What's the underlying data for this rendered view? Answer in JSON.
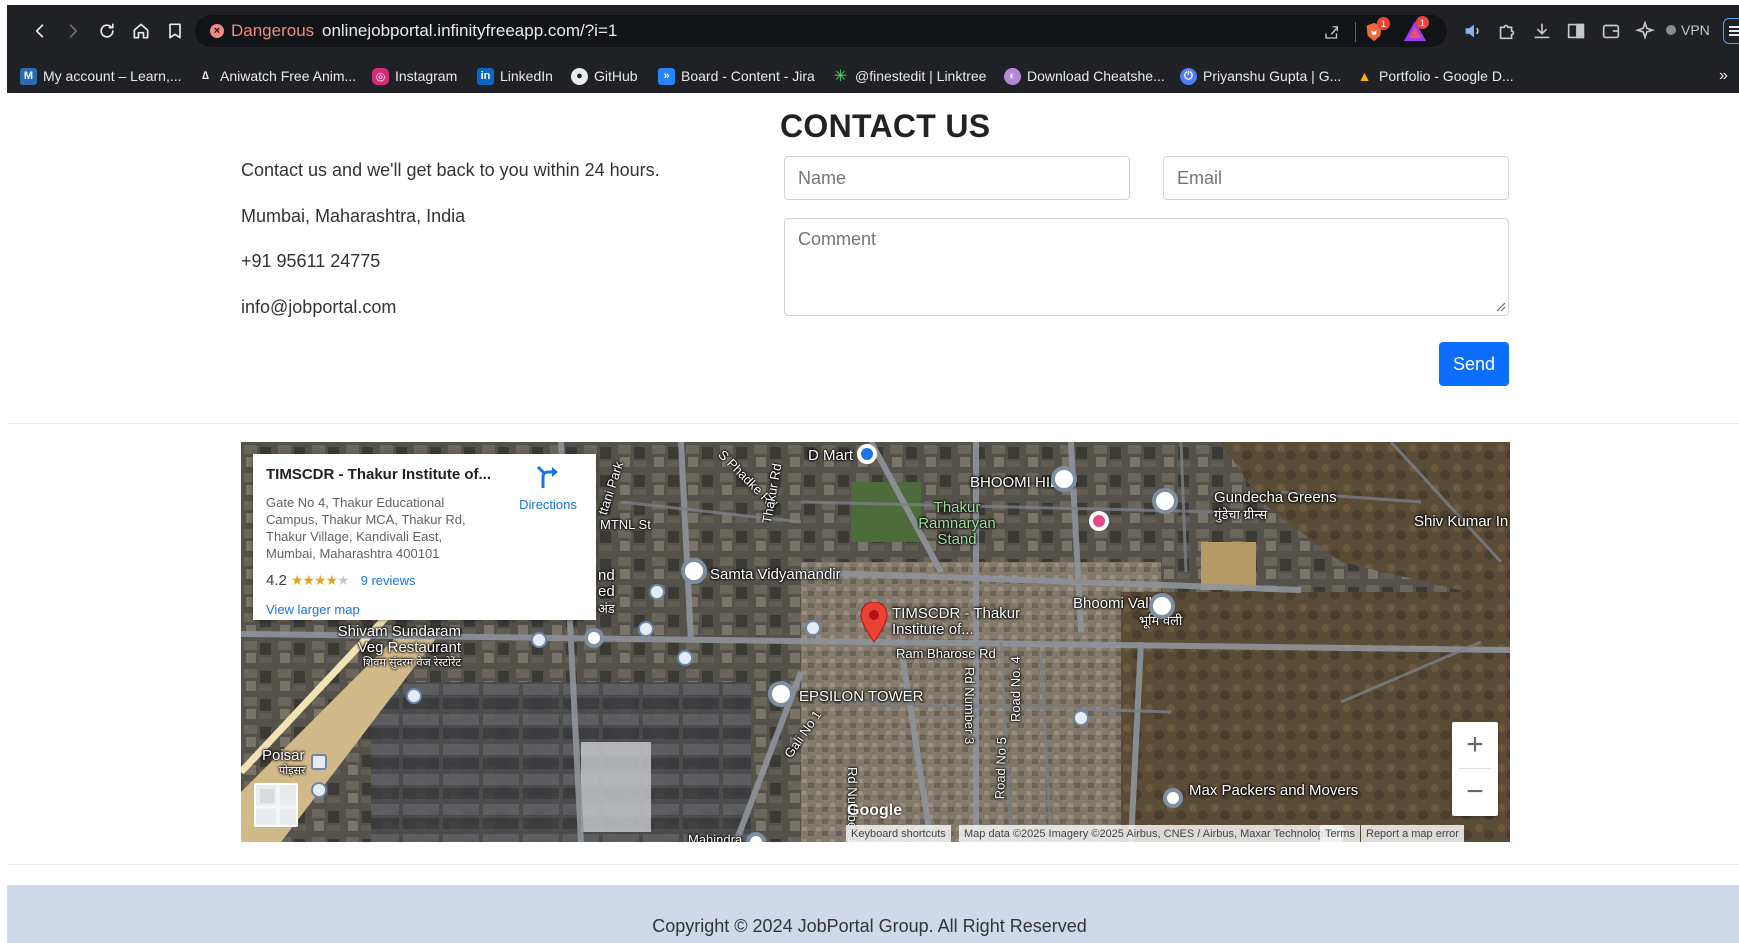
{
  "browser": {
    "security_label": "Dangerous",
    "url": "onlinejobportal.infinityfreeapp.com/?i=1",
    "shield_badge": "1",
    "alert_badge": "1",
    "vpn_label": "VPN",
    "bookmarks": [
      {
        "label": "My account – Learn,...",
        "icon": "account-icon",
        "color": "#2b6cb0"
      },
      {
        "label": "Aniwatch Free Anim...",
        "icon": "aniwatch-icon",
        "color": "#6b6b6b"
      },
      {
        "label": "Instagram",
        "icon": "instagram-icon",
        "color": "#d62976"
      },
      {
        "label": "LinkedIn",
        "icon": "linkedin-icon",
        "color": "#0a66c2"
      },
      {
        "label": "GitHub",
        "icon": "github-icon",
        "color": "#e8eaed"
      },
      {
        "label": "Board - Content - Jira",
        "icon": "jira-icon",
        "color": "#2684ff"
      },
      {
        "label": "@finestedit | Linktree",
        "icon": "linktree-icon",
        "color": "#43e55e"
      },
      {
        "label": "Download Cheatshe...",
        "icon": "cheatsheet-icon",
        "color": "#b48ad8"
      },
      {
        "label": "Priyanshu Gupta | G...",
        "icon": "power-icon",
        "color": "#4f7ff5"
      },
      {
        "label": "Portfolio - Google D...",
        "icon": "drive-icon",
        "color": "#f4b400"
      }
    ]
  },
  "contact": {
    "title": "CONTACT US",
    "intro": "Contact us and we'll get back to you within 24 hours.",
    "address": "Mumbai, Maharashtra, India",
    "phone": "+91 95611 24775",
    "email": "info@jobportal.com",
    "form": {
      "name_placeholder": "Name",
      "email_placeholder": "Email",
      "comment_placeholder": "Comment",
      "send_label": "Send"
    }
  },
  "map": {
    "place_name": "TIMSCDR - Thakur Institute of...",
    "place_address": "Gate No 4, Thakur Educational Campus, Thakur MCA, Thakur Rd, Thakur Village, Kandivali East, Mumbai, Maharashtra 400101",
    "directions_label": "Directions",
    "rating": "4.2",
    "rating_fraction": 0.84,
    "reviews_label": "9 reviews",
    "larger_map_label": "View larger map",
    "labels": {
      "dmart": "D Mart",
      "bhoomi_hills": "BHOOMI HILLS",
      "gundecha": "Gundecha Greens",
      "gundecha_hi": "गुंडेचा ग्रीन्स",
      "shiv_kumar": "Shiv Kumar In",
      "thakur_stand": "Thakur Ramnaryan Stand",
      "samta": "Samta Vidyamandir",
      "mtnl": "MTNL St",
      "timscdr": "TIMSCDR - Thakur Institute of...",
      "ram_bharose": "Ram Bharose Rd",
      "bhoomi_valley": "Bhoomi Valley",
      "bhoomi_valley_hi": "भूमि वैली",
      "shivam": "Shivam Sundaram Veg Restaurant",
      "shivam_hi": "शिवम सुंदरम वेज रेस्टोरेंट",
      "epsilon": "EPSILON TOWER",
      "poisar": "Poisar",
      "poisar_hi": "पोइसर",
      "max_packers": "Max Packers and Movers",
      "mahindra": "Mahindra",
      "google": "Google",
      "sphadke": "S Phadke Rd",
      "thakur_rd": "Thakur Rd",
      "gali": "Gali No 1",
      "rd1": "Rd Number 1",
      "rd3": "Rd Number 3",
      "rdno4": "Road No. 4",
      "rdno5": "Road No 5",
      "nd": "nd",
      "ed": "ed",
      "hind": "अंड",
      "tani": "ttani Park"
    },
    "attribution": {
      "shortcuts": "Keyboard shortcuts",
      "data": "Map data ©2025 Imagery ©2025 Airbus, CNES / Airbus, Maxar Technologies",
      "terms": "Terms",
      "report": "Report a map error"
    },
    "zoom_in": "+",
    "zoom_out": "−"
  },
  "footer": {
    "copyright": "Copyright © 2024 JobPortal Group. All Right Reserved"
  }
}
